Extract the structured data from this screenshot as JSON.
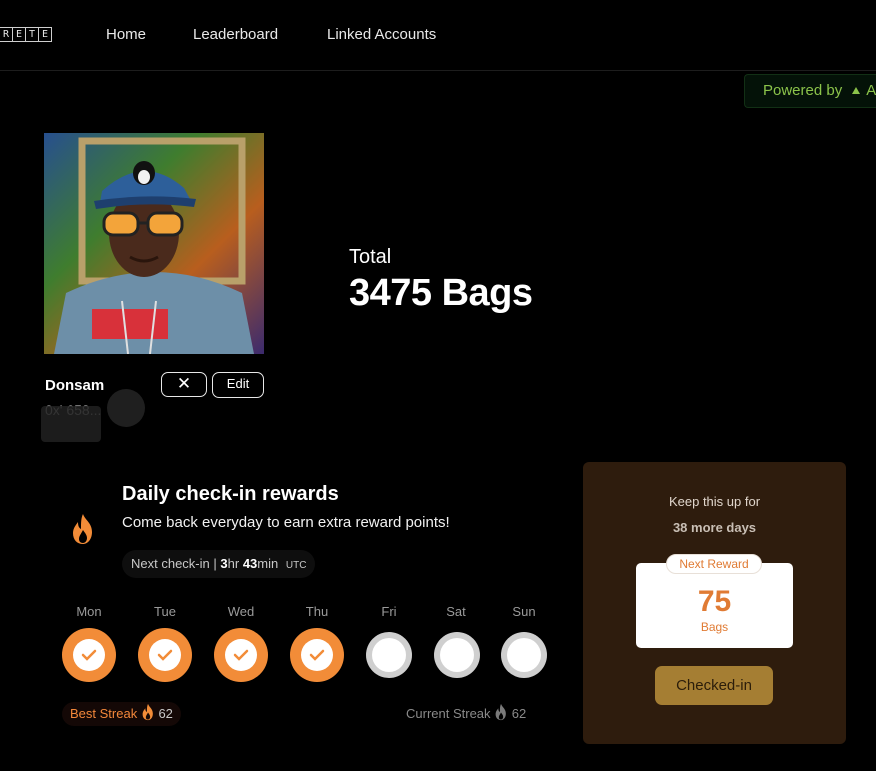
{
  "nav": {
    "logo_letters": [
      "R",
      "E",
      "T",
      "E"
    ],
    "links": [
      "Home",
      "Leaderboard",
      "Linked Accounts"
    ]
  },
  "powered": {
    "label": "Powered by",
    "suffix": "A"
  },
  "profile": {
    "name": "Donsam",
    "address": "0x' 658...",
    "close_symbol": "✕",
    "edit_label": "Edit"
  },
  "total": {
    "label": "Total",
    "value": "3475 Bags"
  },
  "daily": {
    "title": "Daily check-in rewards",
    "subtitle": "Come back everyday to earn extra reward points!",
    "next_label": "Next check-in",
    "next_sep": "|",
    "next_hours": "3",
    "next_hours_unit": "hr",
    "next_minutes": "43",
    "next_minutes_unit": "min",
    "next_tz": "UTC",
    "days": [
      {
        "label": "Mon",
        "checked": true
      },
      {
        "label": "Tue",
        "checked": true
      },
      {
        "label": "Wed",
        "checked": true
      },
      {
        "label": "Thu",
        "checked": true
      },
      {
        "label": "Fri",
        "checked": false
      },
      {
        "label": "Sat",
        "checked": false
      },
      {
        "label": "Sun",
        "checked": false
      }
    ],
    "best_streak_label": "Best Streak",
    "best_streak_value": "62",
    "current_streak_label": "Current Streak",
    "current_streak_value": "62"
  },
  "reward": {
    "keep_up": "Keep this up for",
    "more_days": "38 more days",
    "tag": "Next Reward",
    "value": "75",
    "unit": "Bags",
    "button": "Checked-in"
  },
  "colors": {
    "accent": "#f28c38",
    "reward_card": "#2e1c0d",
    "checked_button": "#a57e33",
    "powered_green": "#8bc34a"
  }
}
